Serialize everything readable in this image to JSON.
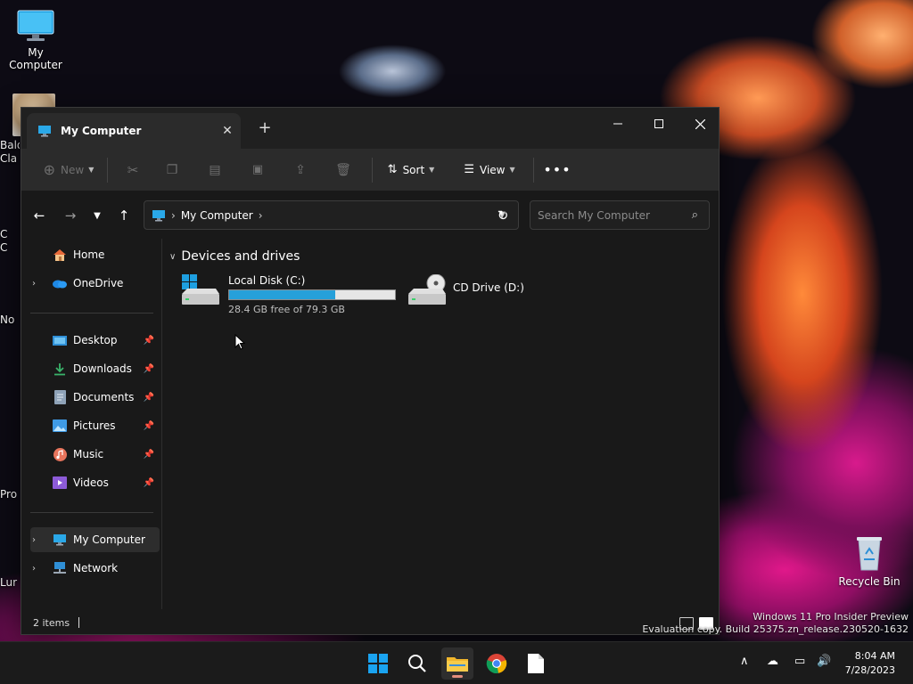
{
  "desktop": {
    "my_computer_label": "My Computer",
    "recycle_bin_label": "Recycle Bin",
    "partial_labels": [
      "Bald",
      "Cla",
      "C",
      "C",
      "No",
      "Pro",
      "Lur"
    ]
  },
  "window": {
    "tab_title": "My Computer",
    "new_tab": "+"
  },
  "toolbar": {
    "new_label": "New",
    "sort_label": "Sort",
    "view_label": "View"
  },
  "address": {
    "location": "My Computer"
  },
  "search": {
    "placeholder": "Search My Computer"
  },
  "sidebar": {
    "home": "Home",
    "onedrive": "OneDrive",
    "quick": [
      {
        "label": "Desktop",
        "icon": "desktop-icon"
      },
      {
        "label": "Downloads",
        "icon": "downloads-icon"
      },
      {
        "label": "Documents",
        "icon": "documents-icon"
      },
      {
        "label": "Pictures",
        "icon": "pictures-icon"
      },
      {
        "label": "Music",
        "icon": "music-icon"
      },
      {
        "label": "Videos",
        "icon": "videos-icon"
      }
    ],
    "my_computer": "My Computer",
    "network": "Network"
  },
  "content": {
    "group_title": "Devices and drives",
    "drives": [
      {
        "name": "Local Disk (C:)",
        "free_text": "28.4 GB free of 79.3 GB",
        "used_fraction": 0.64
      },
      {
        "name": "CD Drive (D:)"
      }
    ]
  },
  "status": {
    "item_count": "2 items"
  },
  "watermark": {
    "line1": "Windows 11 Pro Insider Preview",
    "line2": "Evaluation copy. Build 25375.zn_release.230520-1632"
  },
  "clock": {
    "time": "8:04 AM",
    "date": "7/28/2023"
  },
  "colors": {
    "accent": "#26a0da",
    "window_bg": "#191919",
    "taskbar_bg": "#1b1b1b"
  }
}
